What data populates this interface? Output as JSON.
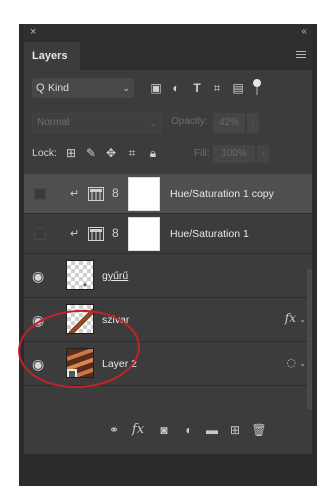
{
  "panel": {
    "close_glyph": "×",
    "collapse_glyph": "‹‹",
    "tab_label": "Layers"
  },
  "filter": {
    "search_glyph": "Q",
    "kind_label": "Kind",
    "dropdown_glyph": "⌄",
    "icons": [
      "image-filter-icon",
      "adjustment-filter-icon",
      "type-filter-icon",
      "shape-filter-icon",
      "smart-object-filter-icon",
      "filter-toggle-icon"
    ]
  },
  "blend": {
    "mode": "Normal",
    "opacity_label": "Opacity:",
    "opacity_value": "42%"
  },
  "lock": {
    "label": "Lock:",
    "fill_label": "Fill:",
    "fill_value": "100%"
  },
  "layers": [
    {
      "name": "Hue/Saturation 1 copy",
      "visible": false,
      "selected": true,
      "type": "adjustment"
    },
    {
      "name": "Hue/Saturation 1",
      "visible": false,
      "selected": false,
      "type": "adjustment"
    },
    {
      "name": "gyűrű",
      "visible": true,
      "selected": false,
      "type": "pixel"
    },
    {
      "name": "szivar",
      "visible": true,
      "selected": false,
      "type": "pixel",
      "has_fx": true
    },
    {
      "name": "Layer 2",
      "visible": true,
      "selected": false,
      "type": "smart-object"
    }
  ],
  "bottom_icons": [
    "link-layers-icon",
    "fx-icon",
    "add-mask-icon",
    "new-adjustment-icon",
    "new-group-icon",
    "new-layer-icon",
    "delete-icon"
  ],
  "glyphs": {
    "fx": "fx",
    "chevron": "⌄",
    "eye": "◉",
    "chain": "8",
    "clip": "↵"
  },
  "annotation_color": "#c0242a"
}
